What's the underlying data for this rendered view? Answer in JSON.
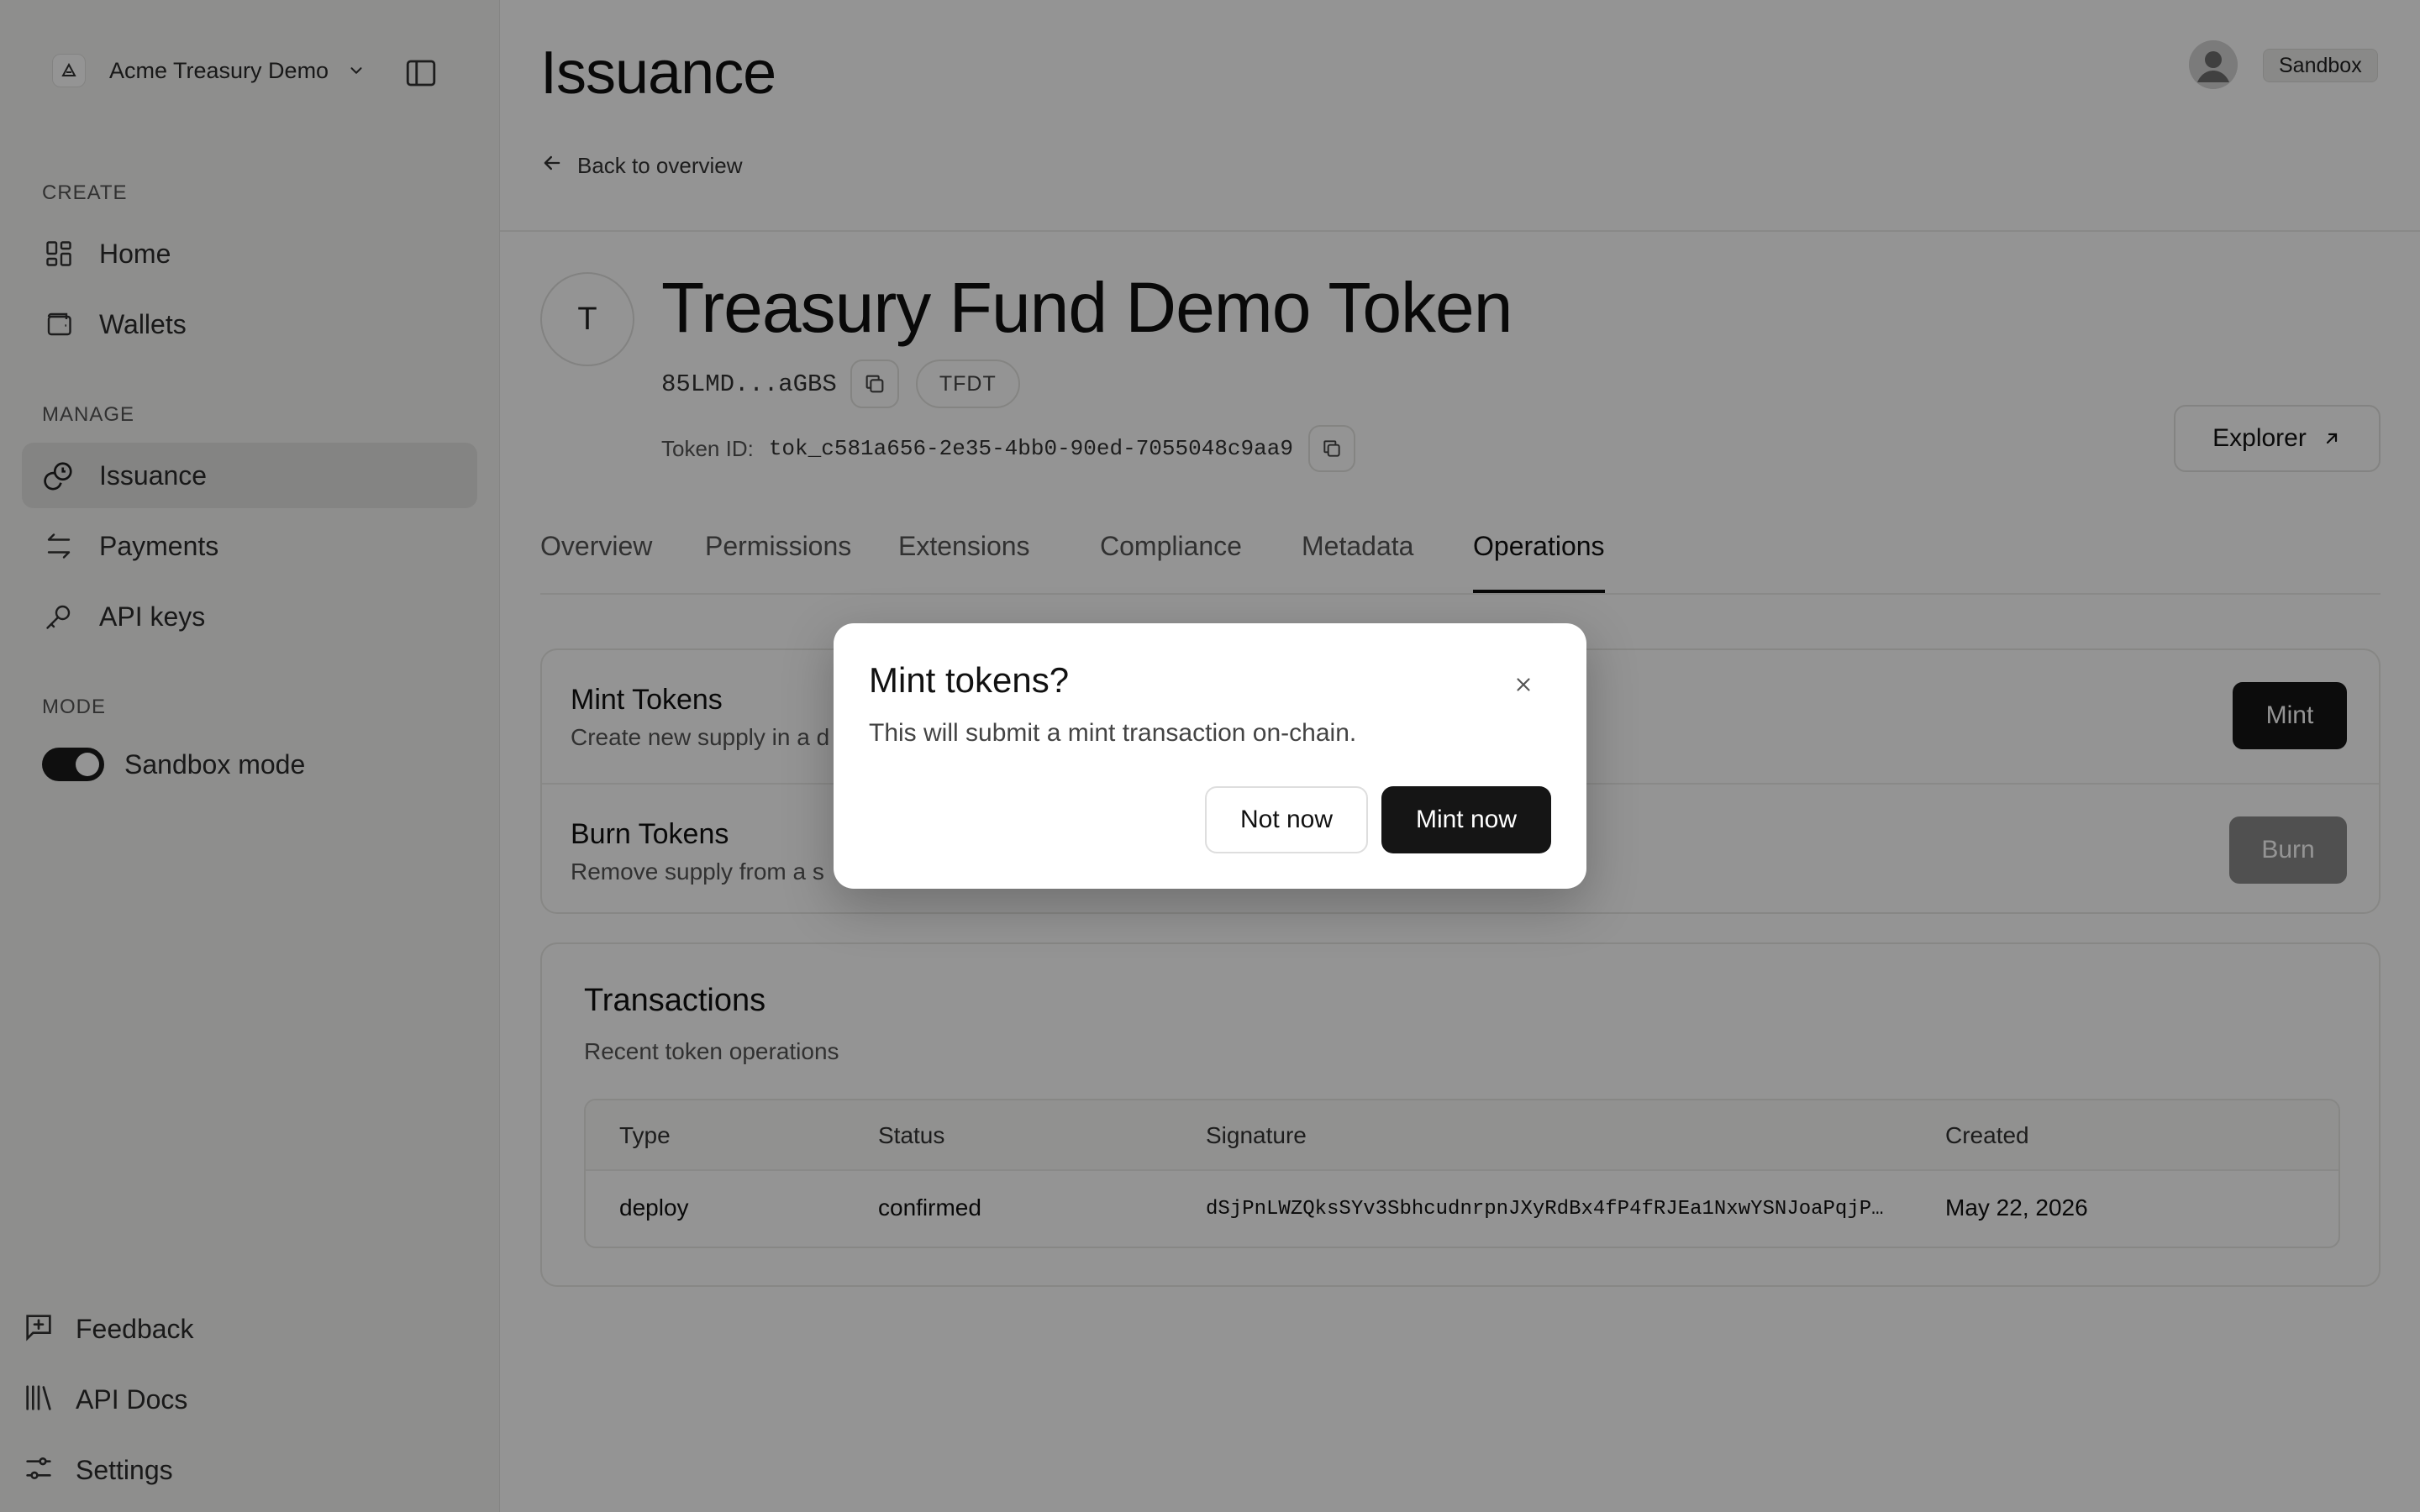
{
  "sidebar": {
    "org_name": "Acme Treasury Demo",
    "sections": {
      "create": "CREATE",
      "manage": "MANAGE",
      "mode": "MODE"
    },
    "items": [
      {
        "label": "Home",
        "icon": "grid-icon"
      },
      {
        "label": "Wallets",
        "icon": "wallet-icon"
      },
      {
        "label": "Issuance",
        "icon": "coins-icon",
        "active": true
      },
      {
        "label": "Payments",
        "icon": "transfer-icon"
      },
      {
        "label": "API keys",
        "icon": "key-icon"
      }
    ],
    "mode_toggle": {
      "label": "Sandbox mode",
      "on": true
    },
    "footer": [
      {
        "label": "Feedback",
        "icon": "feedback-icon"
      },
      {
        "label": "API Docs",
        "icon": "library-icon"
      },
      {
        "label": "Settings",
        "icon": "sliders-icon"
      }
    ]
  },
  "header": {
    "title": "Issuance",
    "back_label": "Back to overview",
    "env_badge": "Sandbox"
  },
  "token": {
    "initial": "T",
    "name": "Treasury Fund Demo Token",
    "address": "85LMD...aGBS",
    "symbol": "TFDT",
    "id_label": "Token ID:",
    "id": "tok_c581a656-2e35-4bb0-90ed-7055048c9aa9",
    "explorer_label": "Explorer"
  },
  "tabs": [
    "Overview",
    "Permissions",
    "Extensions",
    "Compliance",
    "Metadata",
    "Operations"
  ],
  "active_tab": "Operations",
  "operations": {
    "mint": {
      "title": "Mint Tokens",
      "desc": "Create new supply in a d",
      "button": "Mint"
    },
    "burn": {
      "title": "Burn Tokens",
      "desc": "Remove supply from a s",
      "button": "Burn"
    }
  },
  "transactions": {
    "title": "Transactions",
    "subtitle": "Recent token operations",
    "columns": [
      "Type",
      "Status",
      "Signature",
      "Created"
    ],
    "rows": [
      {
        "type": "deploy",
        "status": "confirmed",
        "signature": "dSjPnLWZQksSYv3SbhcudnrpnJXyRdBx4fP4fRJEa1NxwYSNJoaPqjP…",
        "created": "May 22, 2026"
      }
    ]
  },
  "modal": {
    "title": "Mint tokens?",
    "body": "This will submit a mint transaction on-chain.",
    "cancel": "Not now",
    "confirm": "Mint now"
  },
  "colors": {
    "primary_button": "#151515",
    "disabled_button": "#8a8a8a",
    "overlay": "rgba(0,0,0,0.42)"
  }
}
